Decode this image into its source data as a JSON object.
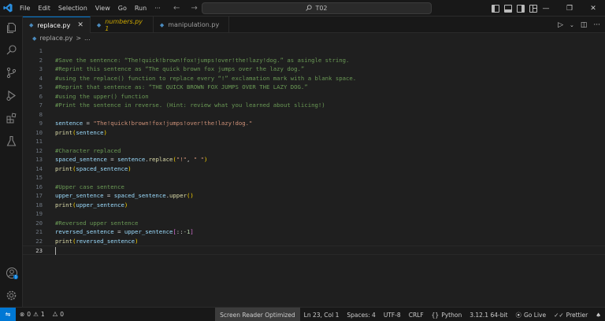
{
  "titlebar": {
    "menu": [
      "File",
      "Edit",
      "Selection",
      "View",
      "Go",
      "Run",
      "···"
    ],
    "search_text": "T02"
  },
  "tabs": [
    {
      "label": "replace.py",
      "active": true
    },
    {
      "label": "numbers.py 1",
      "active": false,
      "warning": true
    },
    {
      "label": "manipulation.py",
      "active": false
    }
  ],
  "breadcrumb": {
    "file": "replace.py",
    "sep": ">",
    "more": "..."
  },
  "code_lines": [
    {
      "n": "1",
      "segs": []
    },
    {
      "n": "2",
      "segs": [
        [
          "c-cm",
          "#Save the sentence: “The!quick!brown!fox!jumps!over!the!lazy!dog.” as asingle string."
        ]
      ]
    },
    {
      "n": "3",
      "segs": [
        [
          "c-cm",
          "#Reprint this sentence as “The quick brown fox jumps over the lazy dog.”"
        ]
      ]
    },
    {
      "n": "4",
      "segs": [
        [
          "c-cm",
          "#using the replace() function to replace every “!” exclamation mark with a blank space."
        ]
      ]
    },
    {
      "n": "5",
      "segs": [
        [
          "c-cm",
          "#Reprint that sentence as: “THE QUICK BROWN FOX JUMPS OVER THE LAZY DOG.”"
        ]
      ]
    },
    {
      "n": "6",
      "segs": [
        [
          "c-cm",
          "#using the upper() function"
        ]
      ]
    },
    {
      "n": "7",
      "segs": [
        [
          "c-cm",
          "#Print the sentence in reverse. (Hint: review what you learned about slicing!)"
        ]
      ]
    },
    {
      "n": "8",
      "segs": []
    },
    {
      "n": "9",
      "segs": [
        [
          "c-var",
          "sentence"
        ],
        [
          "c-op",
          " = "
        ],
        [
          "c-str",
          "\"The!quick!brown!fox!jumps!over!the!lazy!dog.\""
        ]
      ]
    },
    {
      "n": "10",
      "segs": [
        [
          "c-fn",
          "print"
        ],
        [
          "c-br",
          "("
        ],
        [
          "c-var",
          "sentence"
        ],
        [
          "c-br",
          ")"
        ]
      ]
    },
    {
      "n": "11",
      "segs": []
    },
    {
      "n": "12",
      "segs": [
        [
          "c-cm",
          "#Character replaced"
        ]
      ]
    },
    {
      "n": "13",
      "segs": [
        [
          "c-var",
          "spaced_sentence"
        ],
        [
          "c-op",
          " = "
        ],
        [
          "c-var",
          "sentence"
        ],
        [
          "c-op",
          "."
        ],
        [
          "c-fn",
          "replace"
        ],
        [
          "c-br",
          "("
        ],
        [
          "c-str",
          "\"!\""
        ],
        [
          "c-op",
          ", "
        ],
        [
          "c-str",
          "\" \""
        ],
        [
          "c-br",
          ")"
        ]
      ]
    },
    {
      "n": "14",
      "segs": [
        [
          "c-fn",
          "print"
        ],
        [
          "c-br",
          "("
        ],
        [
          "c-var",
          "spaced_sentence"
        ],
        [
          "c-br",
          ")"
        ]
      ]
    },
    {
      "n": "15",
      "segs": []
    },
    {
      "n": "16",
      "segs": [
        [
          "c-cm",
          "#Upper case sentence"
        ]
      ]
    },
    {
      "n": "17",
      "segs": [
        [
          "c-var",
          "upper_sentence"
        ],
        [
          "c-op",
          " = "
        ],
        [
          "c-var",
          "spaced_sentence"
        ],
        [
          "c-op",
          "."
        ],
        [
          "c-fn",
          "upper"
        ],
        [
          "c-br",
          "()"
        ]
      ]
    },
    {
      "n": "18",
      "segs": [
        [
          "c-fn",
          "print"
        ],
        [
          "c-br",
          "("
        ],
        [
          "c-var",
          "upper_sentence"
        ],
        [
          "c-br",
          ")"
        ]
      ]
    },
    {
      "n": "19",
      "segs": []
    },
    {
      "n": "20",
      "segs": [
        [
          "c-cm",
          "#Reversed upper sentence"
        ]
      ]
    },
    {
      "n": "21",
      "segs": [
        [
          "c-var",
          "reversed_sentence"
        ],
        [
          "c-op",
          " = "
        ],
        [
          "c-var",
          "upper_sentence"
        ],
        [
          "c-br2",
          "["
        ],
        [
          "c-op",
          "::"
        ],
        [
          "c-num",
          "-1"
        ],
        [
          "c-br2",
          "]"
        ]
      ]
    },
    {
      "n": "22",
      "segs": [
        [
          "c-fn",
          "print"
        ],
        [
          "c-br",
          "("
        ],
        [
          "c-var",
          "reversed_sentence"
        ],
        [
          "c-br",
          ")"
        ]
      ]
    },
    {
      "n": "23",
      "segs": [],
      "current": true
    }
  ],
  "statusbar": {
    "errors": "0",
    "warnings": "1",
    "ports": "0",
    "screen_reader": "Screen Reader Optimized",
    "position": "Ln 23, Col 1",
    "spaces": "Spaces: 4",
    "encoding": "UTF-8",
    "eol": "CRLF",
    "language": "Python",
    "interpreter": "3.12.1 64-bit",
    "golive": "Go Live",
    "prettier": "Prettier"
  },
  "colors": {
    "accent": "#0078d4",
    "badge": "#0078d4"
  },
  "icons": [
    "vscode-logo",
    "explorer-icon",
    "search-icon",
    "source-control-icon",
    "run-debug-icon",
    "extensions-icon",
    "testing-icon",
    "account-icon",
    "settings-gear-icon"
  ]
}
